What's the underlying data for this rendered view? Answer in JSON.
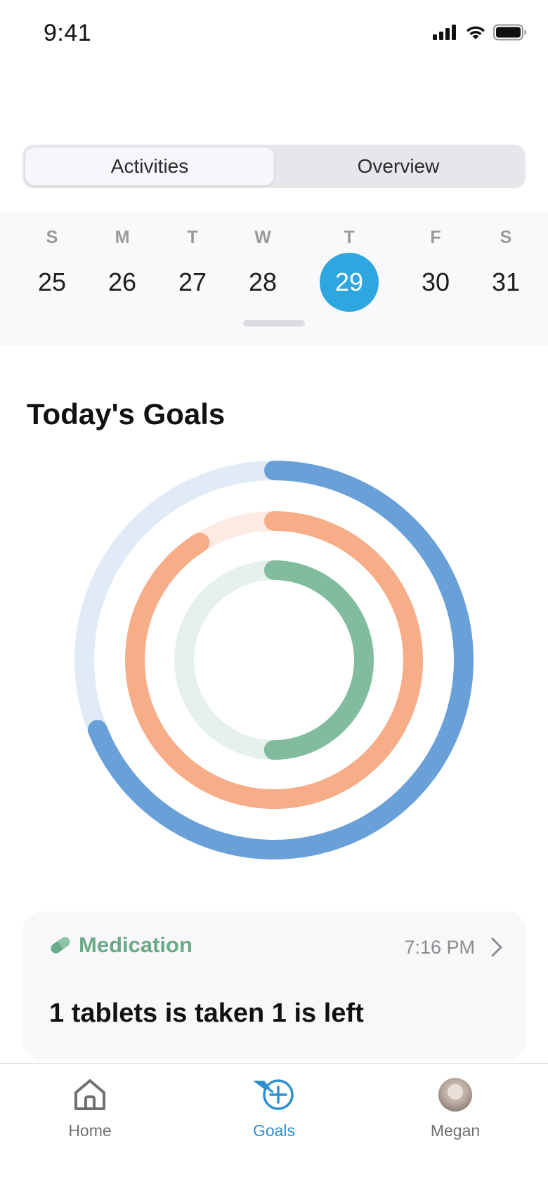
{
  "status_bar": {
    "time": "9:41"
  },
  "segmented_control": {
    "tabs": [
      {
        "label": "Activities",
        "selected": true
      },
      {
        "label": "Overview",
        "selected": false
      }
    ]
  },
  "week": {
    "days": [
      {
        "letter": "S",
        "date": "25"
      },
      {
        "letter": "M",
        "date": "26"
      },
      {
        "letter": "T",
        "date": "27"
      },
      {
        "letter": "W",
        "date": "28"
      },
      {
        "letter": "T",
        "date": "29",
        "selected": true
      },
      {
        "letter": "F",
        "date": "30"
      },
      {
        "letter": "S",
        "date": "31"
      }
    ],
    "selected_color": "#2ea6df"
  },
  "goals": {
    "title": "Today's Goals",
    "rings": [
      {
        "name": "outer",
        "color": "#6aa0d8",
        "track_color": "#e1ebf7",
        "progress": 0.69
      },
      {
        "name": "middle",
        "color": "#f6ad88",
        "track_color": "#fdebe3",
        "progress": 0.91
      },
      {
        "name": "inner",
        "color": "#80bc9d",
        "track_color": "#e5f1ea",
        "progress": 0.5
      }
    ]
  },
  "medication_card": {
    "icon": "pill-icon",
    "title": "Medication",
    "time": "7:16 PM",
    "message": "1 tablets is taken 1 is left",
    "accent_color": "#6aaa86"
  },
  "tab_bar": {
    "items": [
      {
        "label": "Home",
        "icon": "home-icon",
        "active": false
      },
      {
        "label": "Goals",
        "icon": "goals-icon",
        "active": true
      },
      {
        "label": "Megan",
        "icon": "avatar",
        "active": false
      }
    ],
    "active_color": "#2e8fcf"
  }
}
